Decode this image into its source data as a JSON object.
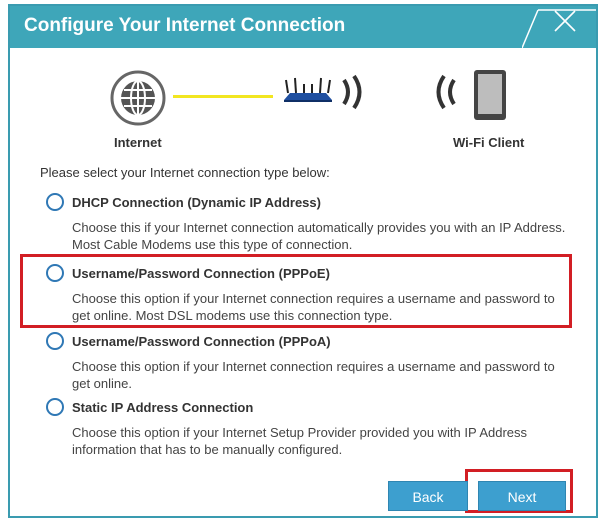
{
  "dialog": {
    "title": "Configure Your Internet Connection",
    "close_icon": "close-icon"
  },
  "diagram": {
    "internet_label": "Internet",
    "client_label": "Wi-Fi Client"
  },
  "prompt": "Please select your Internet connection type below:",
  "options": [
    {
      "title": "DHCP Connection (Dynamic IP Address)",
      "description": "Choose this if your Internet connection automatically provides you with an IP Address. Most Cable Modems use this type of connection.",
      "selected": false
    },
    {
      "title": "Username/Password Connection (PPPoE)",
      "description": "Choose this option if your Internet connection requires a username and password to get online. Most DSL modems use this connection type.",
      "selected": false
    },
    {
      "title": "Username/Password Connection (PPPoA)",
      "description": "Choose this option if your Internet connection requires a username and password to get online.",
      "selected": false
    },
    {
      "title": "Static IP Address Connection",
      "description": "Choose this option if your Internet Setup Provider provided you with IP Address information that has to be manually configured.",
      "selected": false
    }
  ],
  "buttons": {
    "back": "Back",
    "next": "Next"
  },
  "colors": {
    "header": "#3ea6b9",
    "button": "#3d9fcf",
    "highlight": "#d21e24",
    "radio": "#2f78b5"
  }
}
